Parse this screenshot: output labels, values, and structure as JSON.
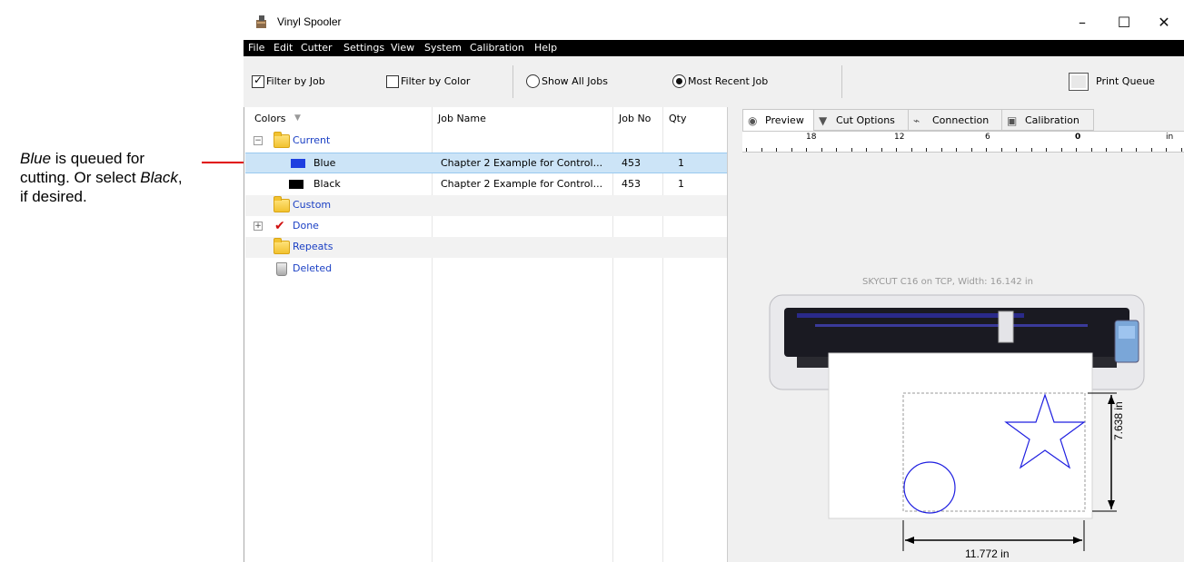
{
  "annotation": {
    "line1_italic": "Blue",
    "line1_rest": " is queued for cutting. Or select ",
    "line2_italic": "Black",
    "line2_rest": ", if desired.",
    "arrow_color": "#e00000"
  },
  "window": {
    "title": "Vinyl Spooler",
    "app_icon": "vinyl-spooler-icon",
    "controls": {
      "minimize": "–",
      "maximize": "☐",
      "close": "✕"
    }
  },
  "menu": [
    "File",
    "Edit",
    "Cutter",
    "Settings",
    "View",
    "System",
    "Calibration",
    "Help"
  ],
  "toolbar": {
    "filter_by_job": {
      "label": "Filter by Job",
      "checked": true
    },
    "filter_by_color": {
      "label": "Filter by Color",
      "checked": false
    },
    "show_all_jobs": {
      "label": "Show All Jobs",
      "selected": false
    },
    "most_recent_job": {
      "label": "Most Recent Job",
      "selected": true
    },
    "print_queue": "Print Queue"
  },
  "list": {
    "columns": [
      "Colors",
      "Job Name",
      "Job No",
      "Qty"
    ],
    "rows": [
      {
        "kind": "folder",
        "name": "Current",
        "expander": "−"
      },
      {
        "kind": "color",
        "name": "Blue",
        "swatch": "#1f3fe0",
        "job_name": "Chapter 2 Example for Control...",
        "job_no": "453",
        "qty": "1",
        "selected": true
      },
      {
        "kind": "color",
        "name": "Black",
        "swatch": "#000000",
        "job_name": "Chapter 2 Example for Control...",
        "job_no": "453",
        "qty": "1"
      },
      {
        "kind": "folder",
        "name": "Custom"
      },
      {
        "kind": "done",
        "name": "Done",
        "expander": "+"
      },
      {
        "kind": "folder",
        "name": "Repeats"
      },
      {
        "kind": "trash",
        "name": "Deleted"
      }
    ]
  },
  "tabs": [
    {
      "label": "Preview",
      "icon": "eye-icon",
      "active": true
    },
    {
      "label": "Cut Options",
      "icon": "blade-icon"
    },
    {
      "label": "Connection",
      "icon": "cable-icon"
    },
    {
      "label": "Calibration",
      "icon": "calibration-icon"
    }
  ],
  "ruler": {
    "labels": [
      "18",
      "12",
      "6",
      "0",
      "in"
    ]
  },
  "preview": {
    "cutter_label": "SKYCUT C16 on TCP,   Width: 16.142 in",
    "height_dim": "7.638 in",
    "width_dim": "11.772 in",
    "shape_color": "#1f1fe0"
  }
}
